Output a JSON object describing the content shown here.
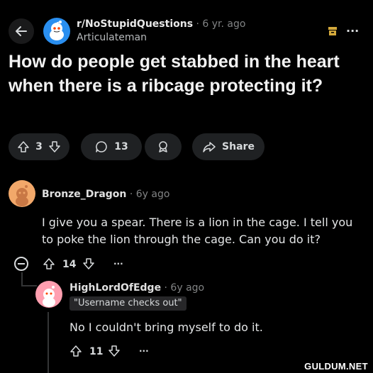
{
  "header": {
    "subreddit": "r/NoStupidQuestions",
    "separator": " · ",
    "age": "6 yr. ago",
    "author": "Articulateman",
    "more_label": "···"
  },
  "post": {
    "title": "How do people get stabbed in the heart when there is a ribcage protecting it?",
    "vote_count": "3",
    "comment_count": "13",
    "share_label": "Share"
  },
  "comments": [
    {
      "author": "Bronze_Dragon",
      "age": "6y ago",
      "body": "I give you a spear. There is a lion in the cage. I tell you to poke the lion through the cage. Can you do it?",
      "votes": "14",
      "more_label": "···"
    },
    {
      "author": "HighLordOfEdge",
      "age": "6y ago",
      "flair": "\"Username checks out\"",
      "body": "No I couldn't bring myself to do it.",
      "votes": "11",
      "more_label": "···"
    }
  ],
  "watermark": "GULDUM.NET",
  "colors": {
    "background": "#000000",
    "pill": "#1f2123",
    "subreddit_avatar": "#2a8ff0",
    "commenter1_avatar": "#f2a86a",
    "commenter2_avatar": "#ff9fb0"
  }
}
